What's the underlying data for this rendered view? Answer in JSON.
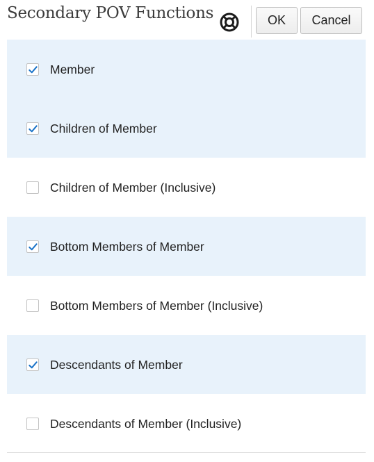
{
  "dialog": {
    "title": "Secondary POV Functions",
    "help_icon": "help-lifebuoy-icon",
    "ok_label": "OK",
    "cancel_label": "Cancel"
  },
  "options": [
    {
      "label": "Member",
      "checked": true
    },
    {
      "label": "Children of Member",
      "checked": true
    },
    {
      "label": "Children of Member (Inclusive)",
      "checked": false
    },
    {
      "label": "Bottom Members of Member",
      "checked": true
    },
    {
      "label": "Bottom Members of Member (Inclusive)",
      "checked": false
    },
    {
      "label": "Descendants of Member",
      "checked": true
    },
    {
      "label": "Descendants of Member (Inclusive)",
      "checked": false
    }
  ],
  "colors": {
    "checked_row_bg": "#e8f2fb",
    "checkmark": "#1a73c8"
  }
}
